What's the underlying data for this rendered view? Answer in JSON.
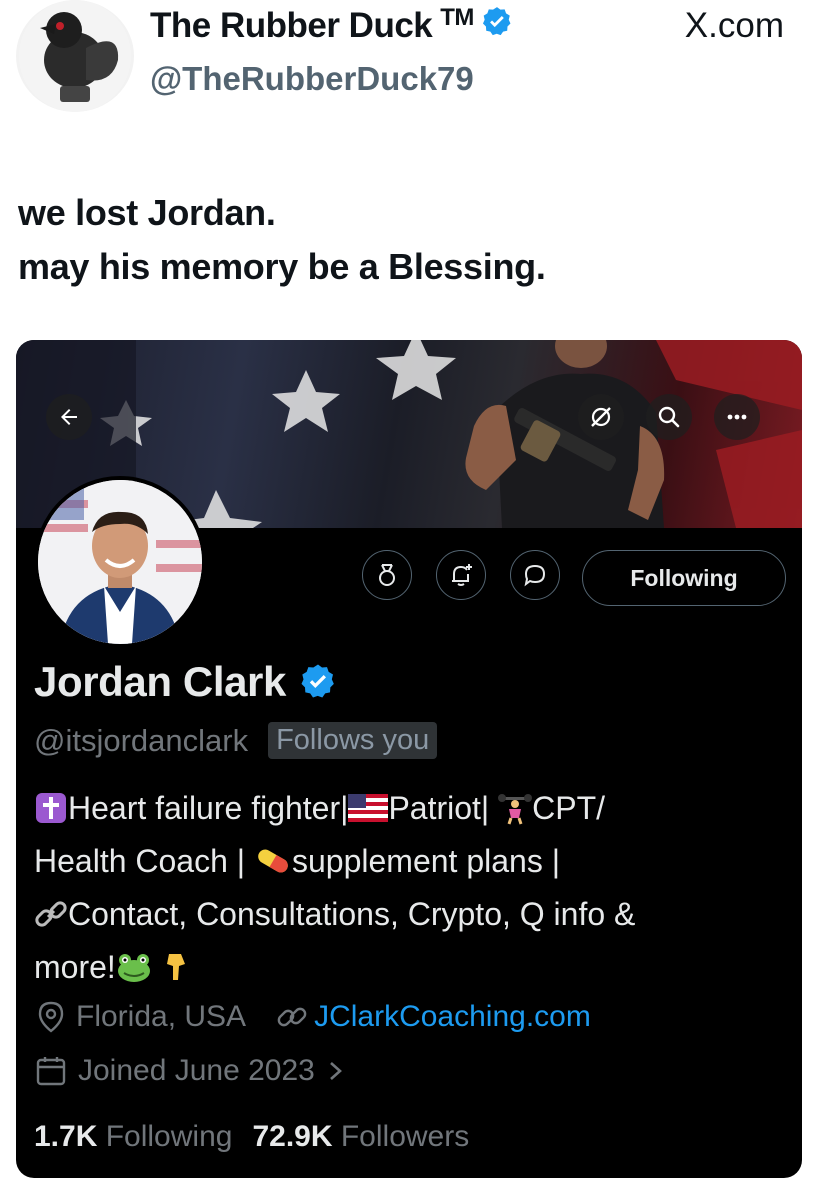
{
  "tweet": {
    "author_name": "The Rubber Duck",
    "author_tm": "TM",
    "author_handle": "@TheRubberDuck79",
    "site": "X.com",
    "text": "we lost Jordan.\nmay his memory be a Blessing."
  },
  "profile": {
    "name": "Jordan Clark",
    "handle": "@itsjordanclark",
    "follows_you": "Follows you",
    "following_button": "Following",
    "bio_lines": [
      "Heart failure fighter|",
      "Patriot|",
      "CPT/",
      "Health Coach |",
      "supplement plans |",
      "Contact, Consultations, Crypto, Q info &",
      "more!"
    ],
    "location": "Florida, USA",
    "website": "JClarkCoaching.com",
    "joined": "Joined June 2023",
    "following_count": "1.7K",
    "following_label": "Following",
    "followers_count": "72.9K",
    "followers_label": "Followers"
  },
  "colors": {
    "verified_blue": "#1d9bf0",
    "card_bg": "#000000",
    "muted_text": "#71767b"
  },
  "icons": [
    "duck-avatar",
    "verified-badge-icon",
    "back-arrow-icon",
    "grok-icon",
    "search-icon",
    "more-icon",
    "medal-icon",
    "notification-bell-icon",
    "message-icon",
    "location-icon",
    "link-icon",
    "calendar-icon"
  ]
}
